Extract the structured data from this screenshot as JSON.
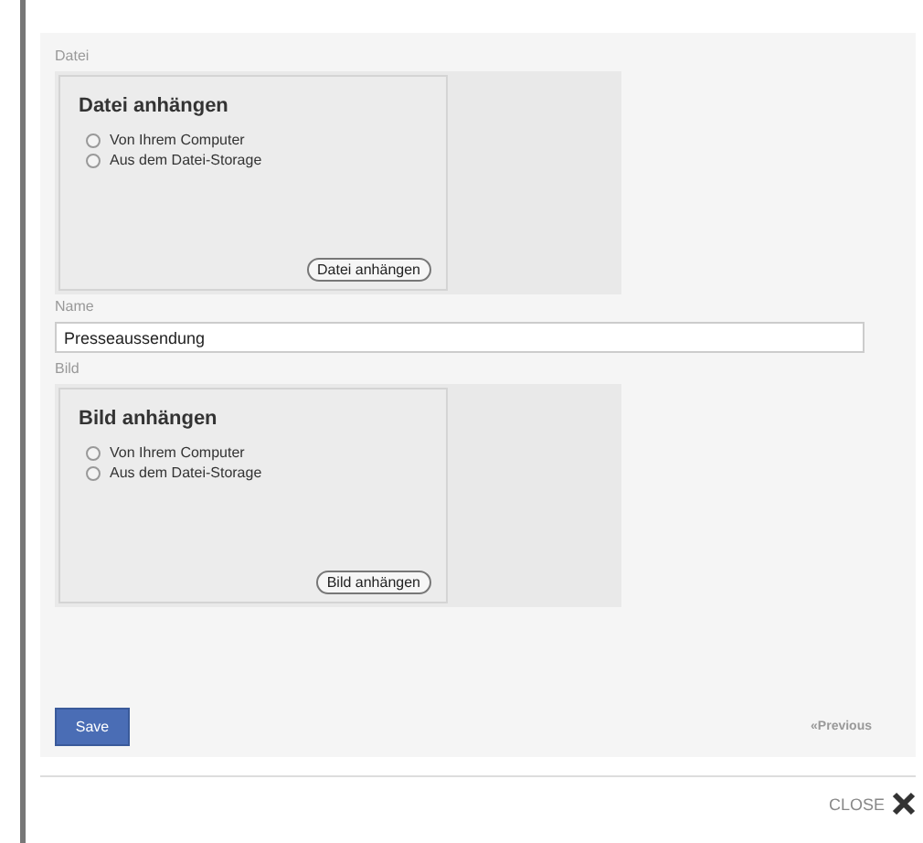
{
  "sections": [
    {
      "label": "Datei",
      "title": "Datei anhängen",
      "options": [
        {
          "label": "Von Ihrem Computer",
          "selected": false
        },
        {
          "label": "Aus dem Datei-Storage",
          "selected": false
        }
      ],
      "button": "Datei anhängen"
    },
    {
      "kind": "field",
      "label": "Name",
      "value": "Presseaussendung"
    },
    {
      "label": "Bild",
      "title": "Bild anhängen",
      "options": [
        {
          "label": "Von Ihrem Computer",
          "selected": false
        },
        {
          "label": "Aus dem Datei-Storage",
          "selected": false
        }
      ],
      "button": "Bild anhängen"
    }
  ],
  "save": "Save",
  "previous": "«Previous",
  "close": "CLOSE"
}
